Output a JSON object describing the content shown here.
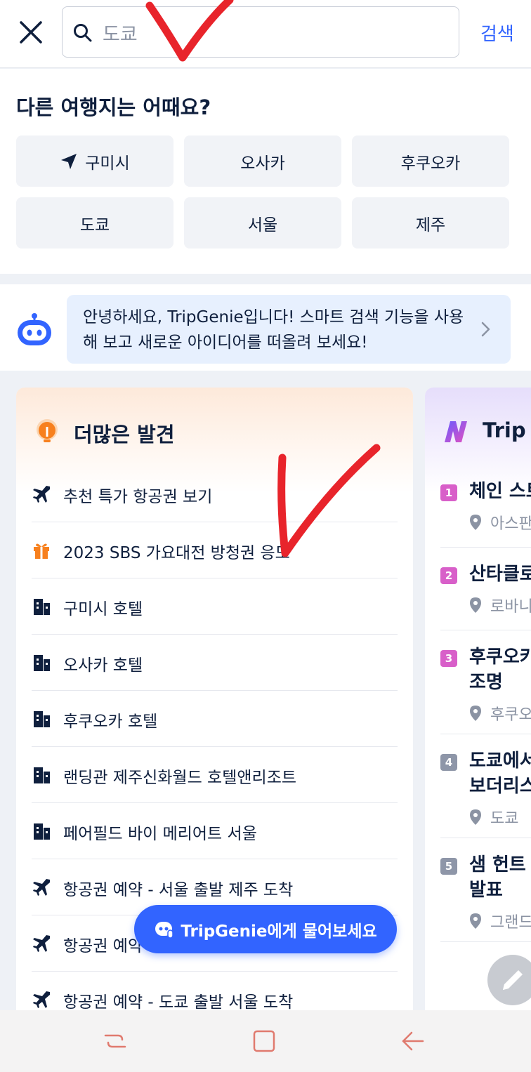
{
  "search": {
    "placeholder": "도쿄",
    "search_label": "검색"
  },
  "suggestions": {
    "heading": "다른 여행지는 어때요?",
    "chips": [
      "구미시",
      "오사카",
      "후쿠오카",
      "도쿄",
      "서울",
      "제주"
    ]
  },
  "genie_banner": {
    "text": "안녕하세요, TripGenie입니다! 스마트 검색 기능을 사용해 보고 새로운 아이디어를 떠올려 보세요!"
  },
  "discover": {
    "title": "더많은 발견",
    "items": [
      {
        "icon": "plane-icon",
        "label": "추천 특가 항공권 보기"
      },
      {
        "icon": "gift-icon",
        "label": "2023 SBS 가요대전 방청권 응모"
      },
      {
        "icon": "hotel-icon",
        "label": "구미시 호텔"
      },
      {
        "icon": "hotel-icon",
        "label": "오사카 호텔"
      },
      {
        "icon": "hotel-icon",
        "label": "후쿠오카 호텔"
      },
      {
        "icon": "hotel-icon",
        "label": "랜딩관 제주신화월드 호텔앤리조트"
      },
      {
        "icon": "hotel-icon",
        "label": "페어필드 바이 메리어트 서울"
      },
      {
        "icon": "plane-icon",
        "label": "항공권 예약 - 서울 출발 제주 도착"
      },
      {
        "icon": "plane-icon",
        "label": "항공권 예약"
      },
      {
        "icon": "plane-icon",
        "label": "항공권 예약 - 도쿄 출발 서울 도착"
      }
    ]
  },
  "trending": {
    "title": "Trip T",
    "items": [
      {
        "rank": "1",
        "color": "#d85fc9",
        "name": [
          "체인 스트"
        ],
        "location": "아스판"
      },
      {
        "rank": "2",
        "color": "#d85fc9",
        "name": [
          "산타클로"
        ],
        "location": "로바니"
      },
      {
        "rank": "3",
        "color": "#d85fc9",
        "name": [
          "후쿠오카",
          "조명"
        ],
        "location": "후쿠오"
      },
      {
        "rank": "4",
        "color": "#8e96a8",
        "name": [
          "도쿄에서",
          "보더리스"
        ],
        "location": "도쿄"
      },
      {
        "rank": "5",
        "color": "#8e96a8",
        "name": [
          "샘 헌트",
          "발표"
        ],
        "location": "그랜드"
      }
    ]
  },
  "fab": {
    "ask_label": "TripGenie에게 물어보세요"
  },
  "colors": {
    "brand_blue": "#3264ff",
    "annotation_red": "#e8242b"
  }
}
